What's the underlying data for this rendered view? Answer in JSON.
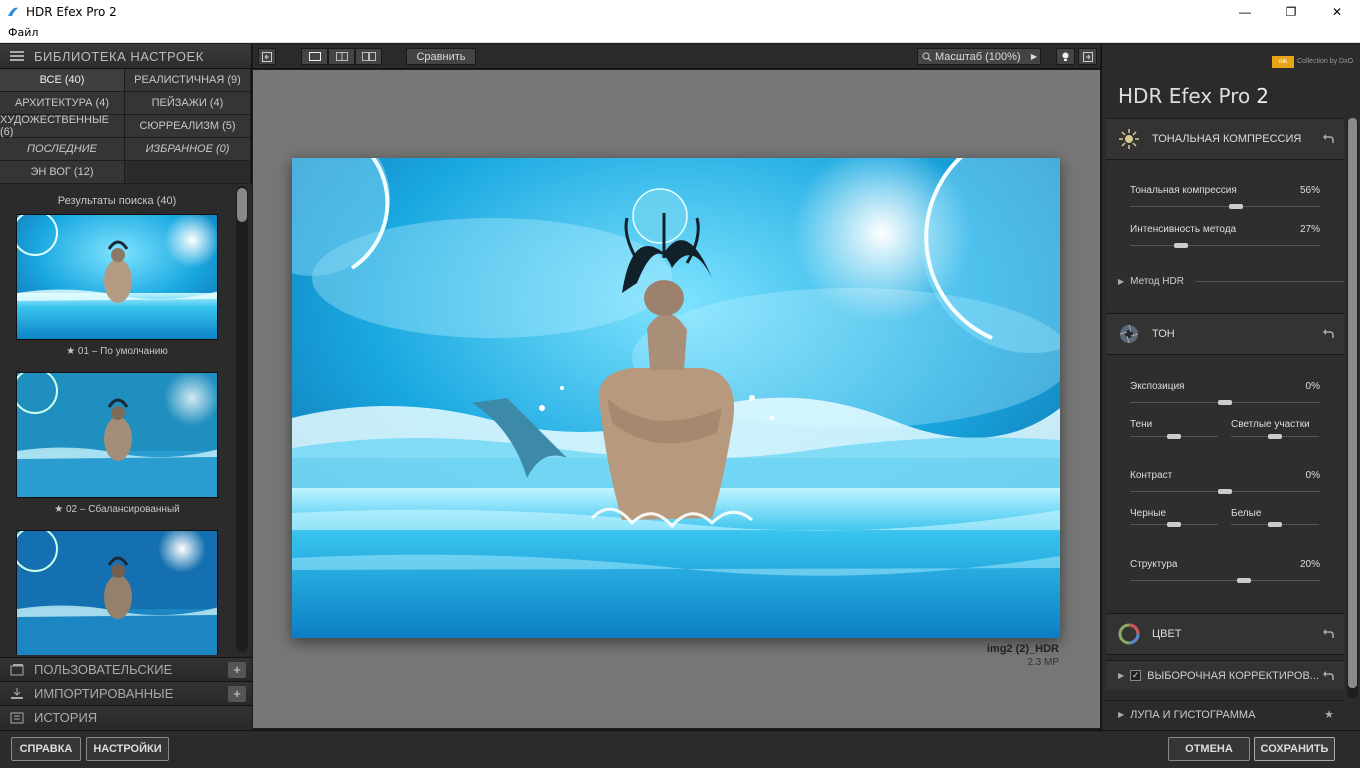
{
  "window": {
    "title": "HDR Efex Pro 2"
  },
  "menu": {
    "file": "Файл"
  },
  "library": {
    "header": "БИБЛИОТЕКА НАСТРОЕК",
    "categories": [
      "ВСЕ (40)",
      "РЕАЛИСТИЧНАЯ (9)",
      "АРХИТЕКТУРА (4)",
      "ПЕЙЗАЖИ (4)",
      "ХУДОЖЕСТВЕННЫЕ (6)",
      "СЮРРЕАЛИЗМ (5)",
      "ПОСЛЕДНИЕ",
      "ИЗБРАННОЕ (0)",
      "ЭН ВОГ (12)"
    ],
    "results_title": "Результаты поиска (40)",
    "presets": [
      {
        "label": "★ 01 – По умолчанию"
      },
      {
        "label": "★ 02 – Сбалансированный"
      },
      {
        "label": ""
      }
    ],
    "sections": {
      "custom": "ПОЛЬЗОВАТЕЛЬСКИЕ",
      "imported": "ИМПОРТИРОВАННЫЕ",
      "history": "ИСТОРИЯ"
    }
  },
  "toolbar": {
    "compare": "Сравнить",
    "zoom": "Масштаб (100%)"
  },
  "image": {
    "name": "img2 (2)_HDR",
    "size": "2.3 MP"
  },
  "right_panel": {
    "brand": "Collection by DxO",
    "nik": "nik",
    "app_title": "HDR Efex Pro",
    "app_version": "2",
    "tonal": {
      "header": "ТОНАЛЬНАЯ КОМПРЕССИЯ",
      "sliders": [
        {
          "label": "Тональная компрессия",
          "value": "56%",
          "level": 0.56
        },
        {
          "label": "Интенсивность метода",
          "value": "27%",
          "level": 0.27
        }
      ],
      "method": "Метод HDR"
    },
    "tone": {
      "header": "ТОН",
      "exposure": {
        "label": "Экспозиция",
        "value": "0%",
        "level": 0.5
      },
      "shadows": {
        "label": "Тени",
        "level": 0.5
      },
      "highlights": {
        "label": "Светлые участки",
        "level": 0.5
      },
      "contrast": {
        "label": "Контраст",
        "value": "0%",
        "level": 0.5
      },
      "blacks": {
        "label": "Черные",
        "level": 0.5
      },
      "whites": {
        "label": "Белые",
        "level": 0.5
      },
      "structure": {
        "label": "Структура",
        "value": "20%",
        "level": 0.6
      }
    },
    "color": {
      "header": "ЦВЕТ"
    },
    "selective": {
      "header": "ВЫБОРОЧНАЯ КОРРЕКТИРОВ..."
    },
    "loupe": {
      "header": "ЛУПА И ГИСТОГРАММА"
    }
  },
  "bottom": {
    "help": "СПРАВКА",
    "settings": "НАСТРОЙКИ",
    "cancel": "ОТМЕНА",
    "save": "СОХРАНИТЬ"
  }
}
